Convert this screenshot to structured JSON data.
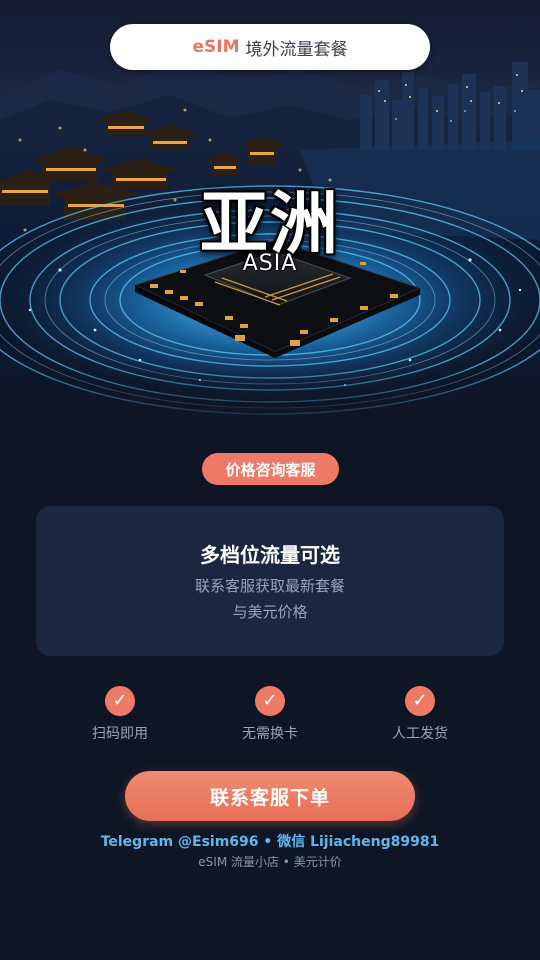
{
  "header": {
    "brand": "eSIM",
    "subtitle": "境外流量套餐"
  },
  "hero": {
    "title": "亚洲",
    "chip_label": "ASIA"
  },
  "consult_badge": "价格咨询客服",
  "info_card": {
    "title": "多档位流量可选",
    "line1": "联系客服获取最新套餐",
    "line2": "与美元价格"
  },
  "features": [
    {
      "icon": "check-icon",
      "label": "扫码即用"
    },
    {
      "icon": "check-icon",
      "label": "无需换卡"
    },
    {
      "icon": "check-icon",
      "label": "人工发货"
    }
  ],
  "cta_label": "联系客服下单",
  "contact_line": "Telegram @Esim696 • 微信 Lijiacheng89981",
  "footer_line": "eSIM 流量小店 • 美元计价",
  "colors": {
    "accent": "#ee7a66",
    "background": "#0e1626",
    "card": "#1b2740",
    "contact": "#5fb7ee"
  }
}
